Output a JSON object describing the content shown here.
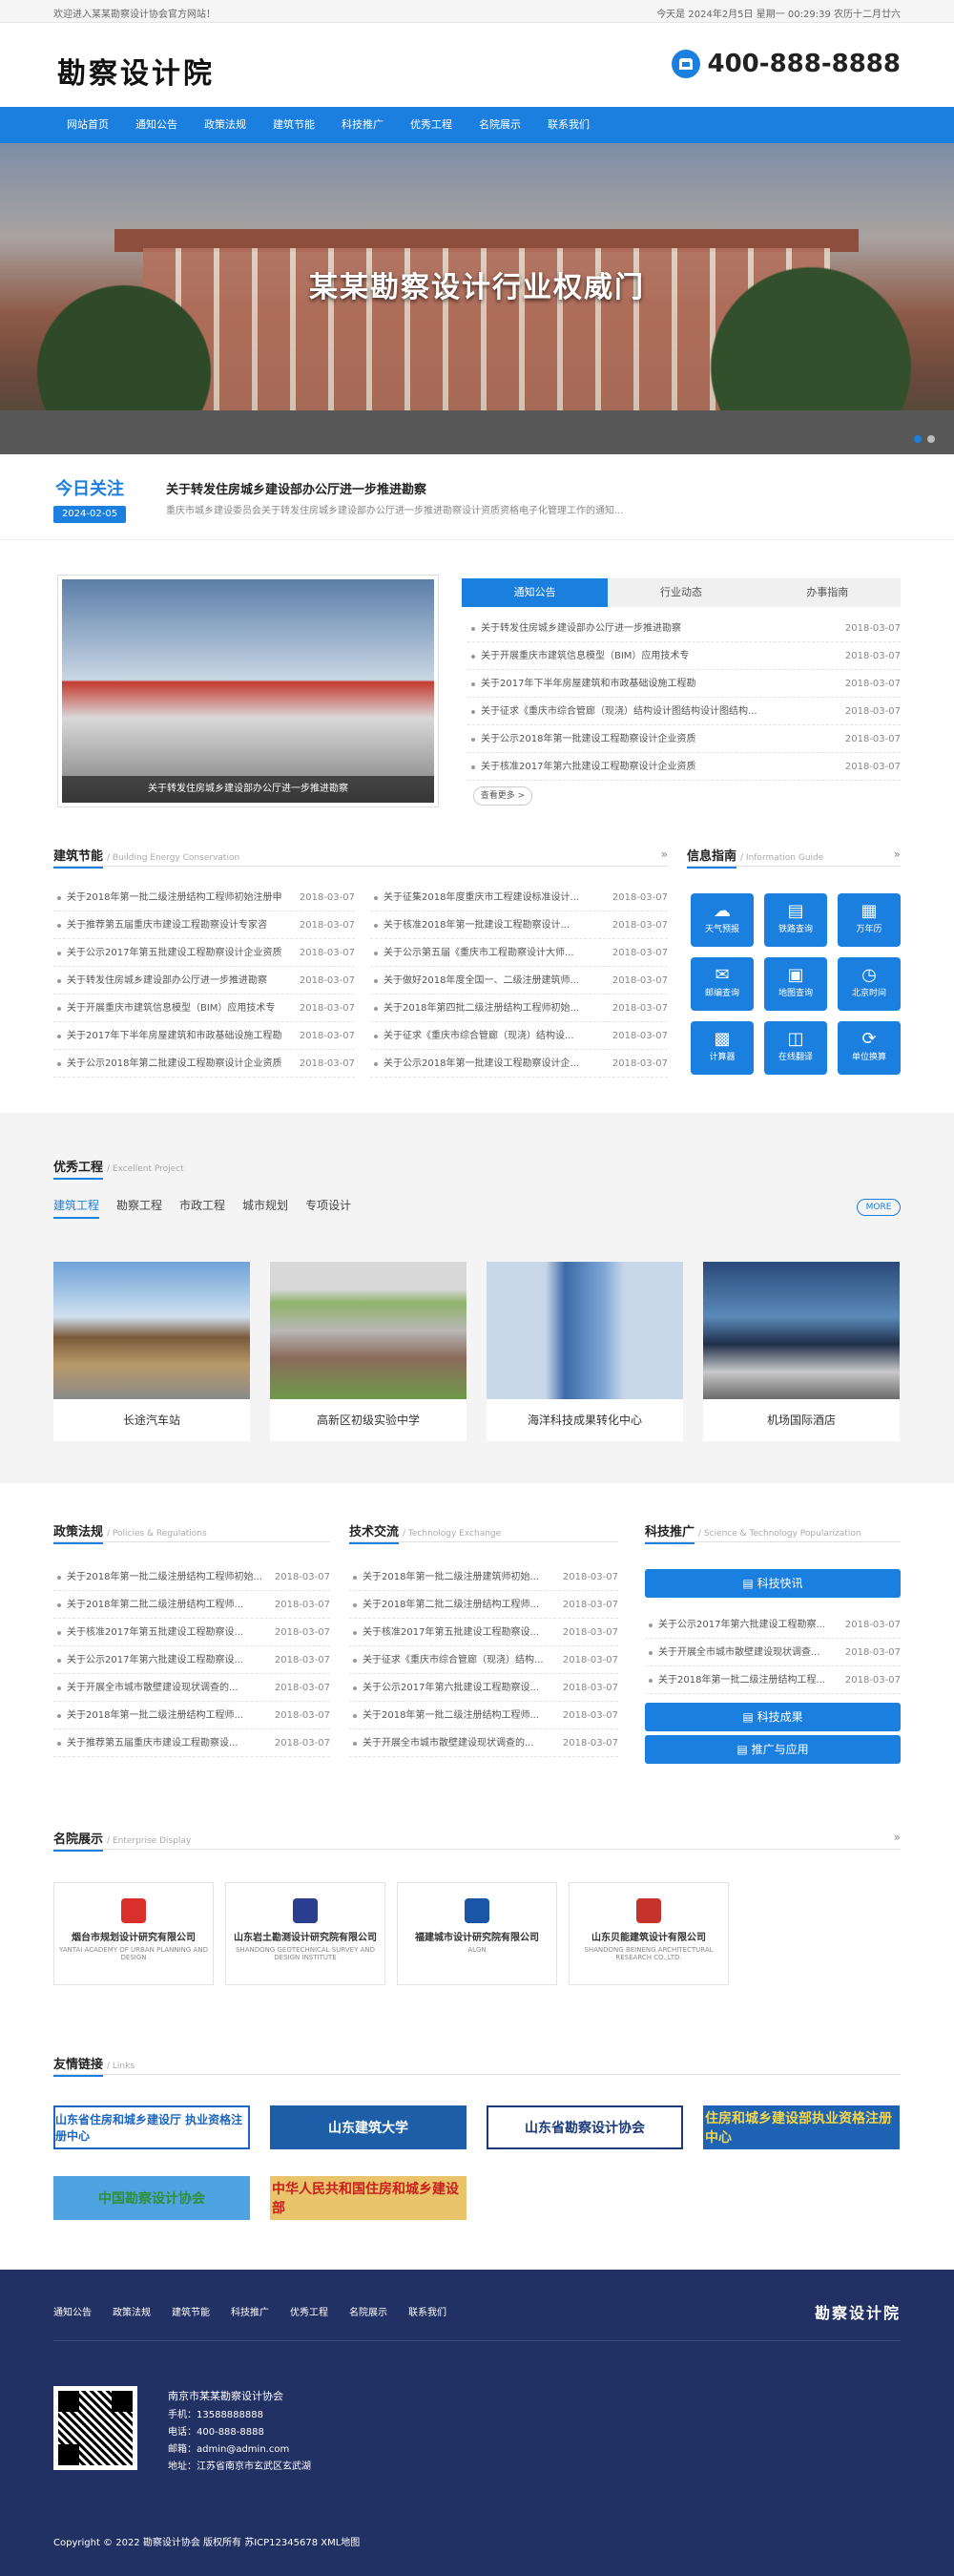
{
  "topbar": {
    "welcome": "欢迎进入某某勘察设计协会官方网站！",
    "date": "今天是 2024年2月5日 星期一 00:29:39 农历十二月廿六"
  },
  "header": {
    "logo": "勘察设计院",
    "phone": "400-888-8888"
  },
  "nav": [
    "网站首页",
    "通知公告",
    "政策法规",
    "建筑节能",
    "科技推广",
    "优秀工程",
    "名院展示",
    "联系我们"
  ],
  "banner": {
    "title": "某某勘察设计行业权威门"
  },
  "today": {
    "label": "今日关注",
    "date": "2024-02-05",
    "title": "关于转发住房城乡建设部办公厅进一步推进勘察",
    "desc": "重庆市城乡建设委员会关于转发住房城乡建设部办公厅进一步推进勘察设计资质资格电子化管理工作的通知..."
  },
  "news": {
    "photo_caption": "关于转发住房城乡建设部办公厅进一步推进勘察",
    "tabs": [
      "通知公告",
      "行业动态",
      "办事指南"
    ],
    "items": [
      {
        "t": "关于转发住房城乡建设部办公厅进一步推进勘察",
        "d": "2018-03-07"
      },
      {
        "t": "关于开展重庆市建筑信息模型（BIM）应用技术专",
        "d": "2018-03-07"
      },
      {
        "t": "关于2017年下半年房屋建筑和市政基础设施工程勘",
        "d": "2018-03-07"
      },
      {
        "t": "关于征求《重庆市综合管廊（现浇）结构设计图结构设计图结构...",
        "d": "2018-03-07"
      },
      {
        "t": "关于公示2018年第一批建设工程勘察设计企业资质",
        "d": "2018-03-07"
      },
      {
        "t": "关于核准2017年第六批建设工程勘察设计企业资质",
        "d": "2018-03-07"
      }
    ],
    "more": "查看更多 >"
  },
  "energy": {
    "name": "建筑节能",
    "en": "/ Building Energy Conservation",
    "left": [
      {
        "t": "关于2018年第一批二级注册结构工程师初始注册申",
        "d": "2018-03-07"
      },
      {
        "t": "关于推荐第五届重庆市建设工程勘察设计专家咨",
        "d": "2018-03-07"
      },
      {
        "t": "关于公示2017年第五批建设工程勘察设计企业资质",
        "d": "2018-03-07"
      },
      {
        "t": "关于转发住房城乡建设部办公厅进一步推进勘察",
        "d": "2018-03-07"
      },
      {
        "t": "关于开展重庆市建筑信息模型（BIM）应用技术专",
        "d": "2018-03-07"
      },
      {
        "t": "关于2017年下半年房屋建筑和市政基础设施工程勘",
        "d": "2018-03-07"
      },
      {
        "t": "关于公示2018年第二批建设工程勘察设计企业资质",
        "d": "2018-03-07"
      }
    ],
    "right": [
      {
        "t": "关于征集2018年度重庆市工程建设标准设计...",
        "d": "2018-03-07"
      },
      {
        "t": "关于核准2018年第一批建设工程勘察设计...",
        "d": "2018-03-07"
      },
      {
        "t": "关于公示第五届《重庆市工程勘察设计大师...",
        "d": "2018-03-07"
      },
      {
        "t": "关于做好2018年度全国一、二级注册建筑师...",
        "d": "2018-03-07"
      },
      {
        "t": "关于2018年第四批二级注册结构工程师初始...",
        "d": "2018-03-07"
      },
      {
        "t": "关于征求《重庆市综合管廊（现浇）结构设...",
        "d": "2018-03-07"
      },
      {
        "t": "关于公示2018年第一批建设工程勘察设计企...",
        "d": "2018-03-07"
      }
    ]
  },
  "guide": {
    "name": "信息指南",
    "en": "/ Information Guide",
    "items": [
      {
        "label": "天气预报",
        "glyph": "☁"
      },
      {
        "label": "铁路查询",
        "glyph": "▤"
      },
      {
        "label": "万年历",
        "glyph": "▦"
      },
      {
        "label": "邮编查询",
        "glyph": "✉"
      },
      {
        "label": "地图查询",
        "glyph": "▣"
      },
      {
        "label": "北京时间",
        "glyph": "◷"
      },
      {
        "label": "计算器",
        "glyph": "▩"
      },
      {
        "label": "在线翻译",
        "glyph": "◫"
      },
      {
        "label": "单位换算",
        "glyph": "⟳"
      }
    ]
  },
  "projects": {
    "name": "优秀工程",
    "en": "/ Excellent Project",
    "tabs": [
      "建筑工程",
      "勘察工程",
      "市政工程",
      "城市规划",
      "专项设计"
    ],
    "more": "MORE",
    "items": [
      "长途汽车站",
      "高新区初级实验中学",
      "海洋科技成果转化中心",
      "机场国际酒店"
    ]
  },
  "policy": {
    "name": "政策法规",
    "en": "/ Policies & Regulations",
    "items": [
      {
        "t": "关于2018年第一批二级注册结构工程师初始...",
        "d": "2018-03-07"
      },
      {
        "t": "关于2018年第二批二级注册结构工程师...",
        "d": "2018-03-07"
      },
      {
        "t": "关于核准2017年第五批建设工程勘察设...",
        "d": "2018-03-07"
      },
      {
        "t": "关于公示2017年第六批建设工程勘察设...",
        "d": "2018-03-07"
      },
      {
        "t": "关于开展全市城市散壁建设现状调查的...",
        "d": "2018-03-07"
      },
      {
        "t": "关于2018年第一批二级注册结构工程师...",
        "d": "2018-03-07"
      },
      {
        "t": "关于推荐第五届重庆市建设工程勘察设...",
        "d": "2018-03-07"
      }
    ]
  },
  "tech": {
    "name": "技术交流",
    "en": "/ Technology Exchange",
    "items": [
      {
        "t": "关于2018年第一批二级注册建筑师初始...",
        "d": "2018-03-07"
      },
      {
        "t": "关于2018年第二批二级注册结构工程师...",
        "d": "2018-03-07"
      },
      {
        "t": "关于核准2017年第五批建设工程勘察设...",
        "d": "2018-03-07"
      },
      {
        "t": "关于征求《重庆市综合管廊（现浇）结构...",
        "d": "2018-03-07"
      },
      {
        "t": "关于公示2017年第六批建设工程勘察设...",
        "d": "2018-03-07"
      },
      {
        "t": "关于2018年第一批二级注册结构工程师...",
        "d": "2018-03-07"
      },
      {
        "t": "关于开展全市城市散壁建设现状调查的...",
        "d": "2018-03-07"
      }
    ]
  },
  "sci": {
    "name": "科技推广",
    "en": "/ Science & Technology Popularization",
    "btn1": "科技快讯",
    "items": [
      {
        "t": "关于公示2017年第六批建设工程勘察...",
        "d": "2018-03-07"
      },
      {
        "t": "关于开展全市城市散壁建设现状调查...",
        "d": "2018-03-07"
      },
      {
        "t": "关于2018年第一批二级注册结构工程...",
        "d": "2018-03-07"
      }
    ],
    "btn2": "科技成果",
    "btn3": "推广与应用"
  },
  "enterprise": {
    "name": "名院展示",
    "en": "/ Enterprise Display",
    "items": [
      {
        "n": "烟台市规划设计研究有限公司",
        "e": "YANTAI ACADEMY OF URBAN PLANNING AND DESIGN",
        "c": "#d9302c"
      },
      {
        "n": "山东岩土勘测设计研究院有限公司",
        "e": "SHANDONG GEOTECHNICAL SURVEY AND DESIGN INSTITUTE",
        "c": "#2a3d8f"
      },
      {
        "n": "福建城市设计研究院有限公司",
        "e": "ALGN",
        "c": "#1a56a8"
      },
      {
        "n": "山东贝能建筑设计有限公司",
        "e": "SHANDONG BEINENG ARCHITECTURAL RESEARCH CO.,LTD.",
        "c": "#c8322c"
      }
    ]
  },
  "links": {
    "name": "友情链接",
    "en": "/ Links",
    "items": [
      {
        "t": "山东省住房和城乡建设厅 执业资格注册中心",
        "c": "#1b66c0",
        "bg": "#ffffff",
        "bd": "#1b66c0"
      },
      {
        "t": "山东建筑大学",
        "c": "#ffffff",
        "bg": "#1d5ea8",
        "bd": "#1d5ea8"
      },
      {
        "t": "山东省勘察设计协会",
        "c": "#1b3a7a",
        "bg": "#ffffff",
        "bd": "#1b3a7a"
      },
      {
        "t": "住房和城乡建设部执业资格注册中心",
        "c": "#f2d64b",
        "bg": "#1f63b5",
        "bd": "#1f63b5"
      },
      {
        "t": "中国勘察设计协会",
        "c": "#2f8f3a",
        "bg": "#4fa3e0",
        "bd": "#4fa3e0"
      },
      {
        "t": "中华人民共和国住房和城乡建设部",
        "c": "#c81e1e",
        "bg": "#e9c46a",
        "bd": "#e9c46a"
      }
    ]
  },
  "footer": {
    "nav": [
      "通知公告",
      "政策法规",
      "建筑节能",
      "科技推广",
      "优秀工程",
      "名院展示",
      "联系我们"
    ],
    "logo": "勘察设计院",
    "org": "南京市某某勘察设计协会",
    "mobile": "手机：13588888888",
    "tel": "电话：400-888-8888",
    "email": "邮箱：admin@admin.com",
    "addr": "地址：江苏省南京市玄武区玄武湖",
    "copyright": "Copyright © 2022 勘察设计协会 版权所有 苏ICP12345678 XML地图"
  },
  "colors": {
    "primary": "#1b7fe0",
    "footer": "#213163"
  }
}
